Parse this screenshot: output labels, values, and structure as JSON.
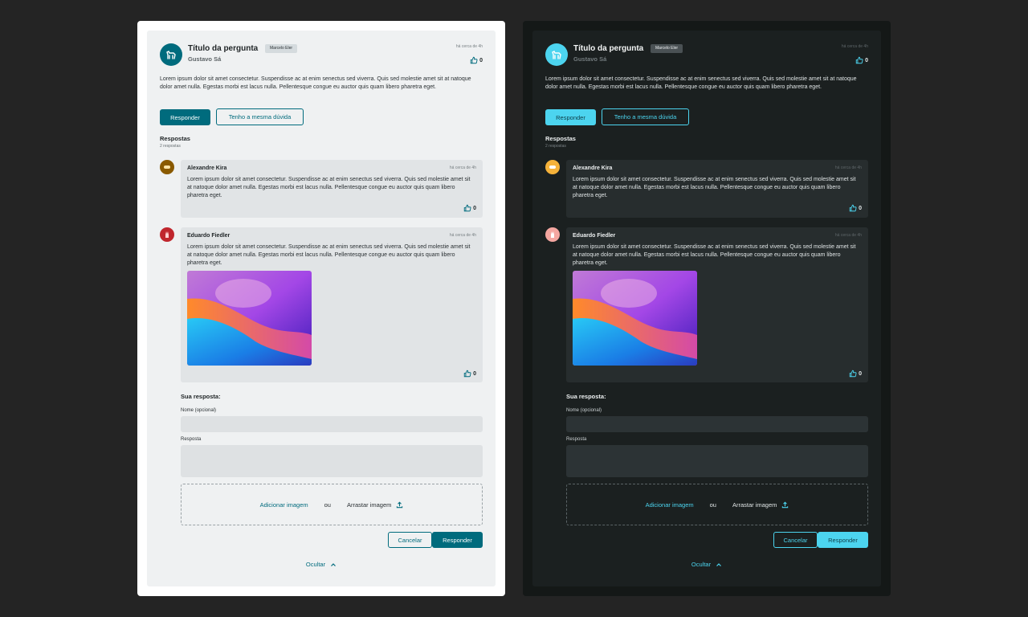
{
  "question": {
    "title": "Título da pergunta",
    "tag": "Marcelo Eler",
    "author": "Gustavo Sá",
    "time": "há cerca de 4h",
    "likes": "0",
    "body": "Lorem ipsum dolor sit amet consectetur. Suspendisse ac at enim senectus sed viverra. Quis sed molestie amet sit at natoque dolor amet nulla. Egestas morbi est lacus nulla. Pellentesque congue eu auctor quis quam libero pharetra eget.",
    "reply_label": "Responder",
    "same_doubt_label": "Tenho a mesma dúvida"
  },
  "answers": {
    "heading": "Respostas",
    "count": "2 respostas",
    "items": [
      {
        "name": "Alexandre Kira",
        "time": "há cerca de 4h",
        "text": "Lorem ipsum dolor sit amet consectetur. Suspendisse ac at enim senectus sed viverra. Quis sed molestie amet sit at natoque dolor amet nulla. Egestas morbi est lacus nulla. Pellentesque congue eu auctor quis quam libero pharetra eget.",
        "likes": "0"
      },
      {
        "name": "Eduardo Fiedler",
        "time": "há cerca de 4h",
        "text": "Lorem ipsum dolor sit amet consectetur. Suspendisse ac at enim senectus sed viverra. Quis sed molestie amet sit at natoque dolor amet nulla. Egestas morbi est lacus nulla. Pellentesque congue eu auctor quis quam libero pharetra eget.",
        "likes": "0"
      }
    ]
  },
  "form": {
    "title": "Sua resposta:",
    "name_label": "Nome (opcional)",
    "reply_label": "Resposta",
    "add_image": "Adicionar imagem",
    "or": "ou",
    "drag_image": "Arrastar imagem",
    "cancel": "Cancelar",
    "submit": "Responder"
  },
  "hide_label": "Ocultar",
  "colors": {
    "light_accent": "#006b7d",
    "dark_accent": "#4cd4ef",
    "avatar_alexandre": "#8a5a00",
    "avatar_eduardo": "#c0262d"
  }
}
